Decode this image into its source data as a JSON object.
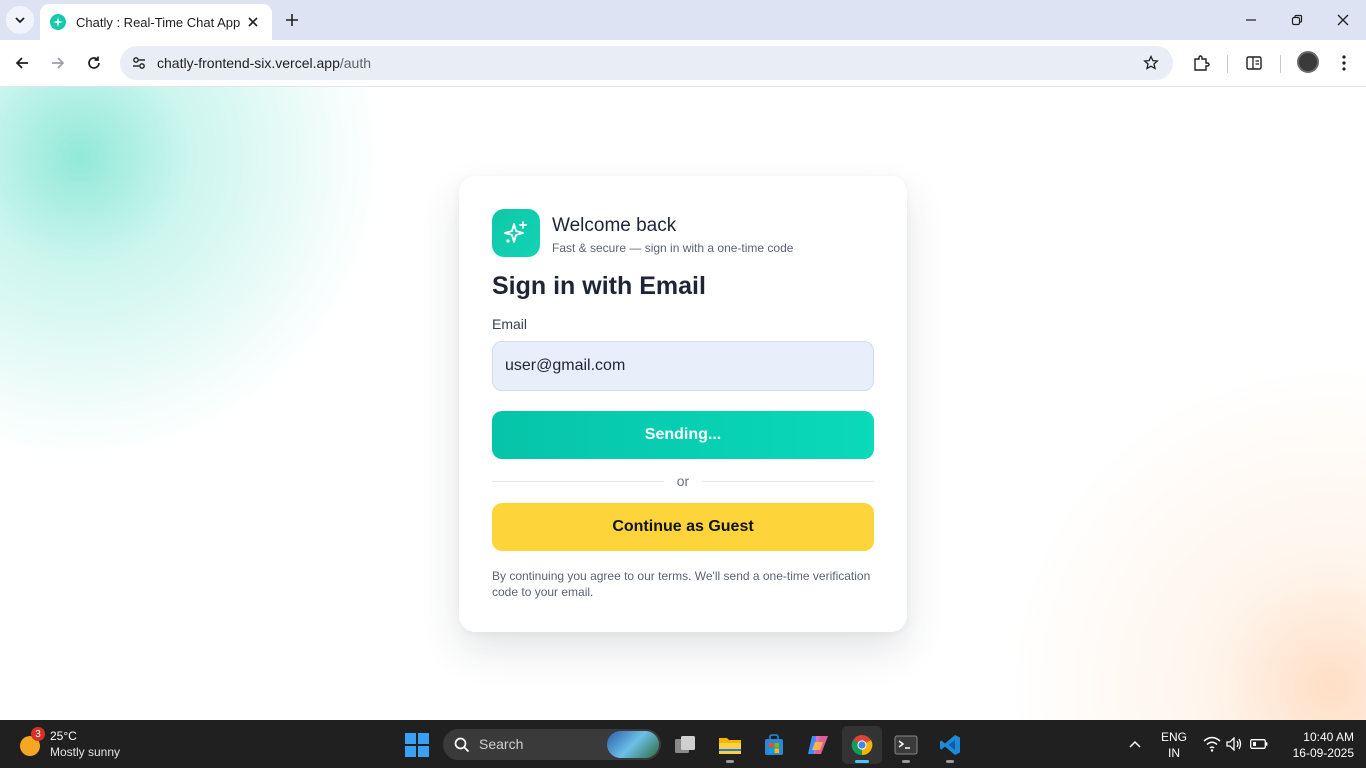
{
  "browser": {
    "tab_title": "Chatly : Real-Time Chat App",
    "url_host": "chatly-frontend-six.vercel.app",
    "url_path": "/auth"
  },
  "auth": {
    "welcome": "Welcome back",
    "tagline": "Fast & secure — sign in with a one-time code",
    "heading": "Sign in with Email",
    "email_label": "Email",
    "email_value": "user@gmail.com",
    "send_button": "Sending...",
    "divider": "or",
    "guest_button": "Continue as Guest",
    "terms": "By continuing you agree to our terms. We'll send a one-time verification code to your email."
  },
  "taskbar": {
    "weather_badge": "3",
    "temperature": "25°C",
    "condition": "Mostly sunny",
    "search_placeholder": "Search",
    "lang_top": "ENG",
    "lang_bottom": "IN",
    "time": "10:40 AM",
    "date": "16-09-2025"
  },
  "colors": {
    "accent": "#0ccfb2",
    "guest": "#fdd53a",
    "heading": "#1e2535"
  }
}
